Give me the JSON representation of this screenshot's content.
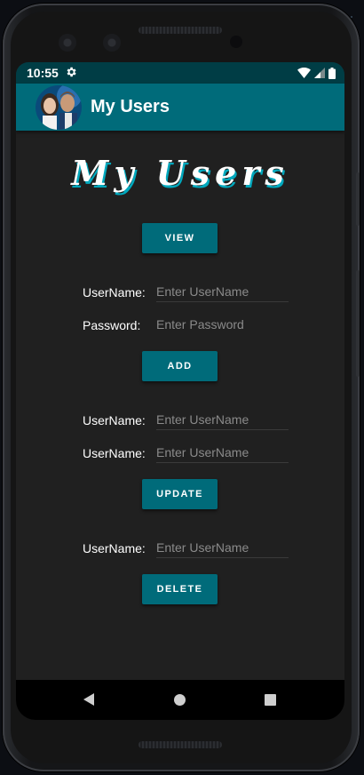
{
  "status_bar": {
    "time": "10:55"
  },
  "app_bar": {
    "title": "My Users"
  },
  "hero": {
    "title": "My Users"
  },
  "view_section": {
    "button_label": "VIEW"
  },
  "add_section": {
    "username_label": "UserName:",
    "username_placeholder": "Enter UserName",
    "password_label": "Password:",
    "password_placeholder": "Enter Password",
    "button_label": "ADD"
  },
  "update_section": {
    "username_label_1": "UserName:",
    "username_placeholder_1": "Enter UserName",
    "username_label_2": "UserName:",
    "username_placeholder_2": "Enter UserName",
    "button_label": "UPDATE"
  },
  "delete_section": {
    "username_label": "UserName:",
    "username_placeholder": "Enter UserName",
    "button_label": "DELETE"
  },
  "nav": {
    "back": "back-icon",
    "home": "home-icon",
    "recents": "recents-icon"
  },
  "colors": {
    "accent": "#006b7a",
    "status_bar": "#003d45",
    "background": "#202020",
    "hero_shadow": "#00a8bd"
  }
}
